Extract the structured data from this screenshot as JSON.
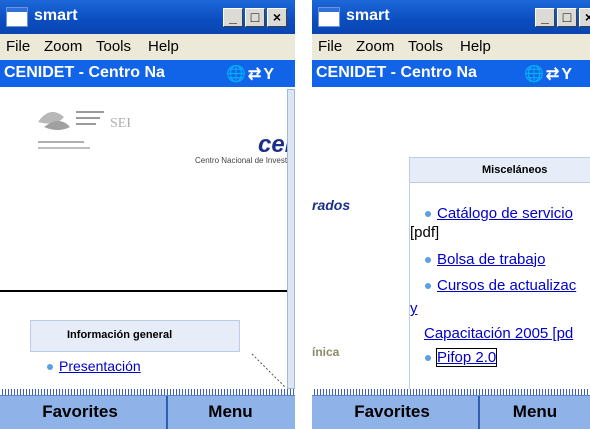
{
  "windows": [
    {
      "id": "left",
      "title": "smart",
      "controls": {
        "minimize": "_",
        "maximize": "□",
        "close": "×"
      },
      "menu": [
        "File",
        "Zoom",
        "Tools",
        "Help"
      ],
      "address": "CENIDET - Centro Na",
      "content": {
        "brand_partial": "cer",
        "center_text": "Centro Nacional de Invest",
        "section_title": "Información general",
        "links": [
          "Presentación"
        ]
      },
      "softkeys": {
        "left": "Favorites",
        "right": "Menu"
      }
    },
    {
      "id": "right",
      "title": "smart",
      "controls": {
        "minimize": "_",
        "maximize": "□",
        "close": "×"
      },
      "menu": [
        "File",
        "Zoom",
        "Tools",
        "Help"
      ],
      "address": "CENIDET - Centro Na",
      "content": {
        "side_label": "rados",
        "side_label2": "ínica",
        "box_title": "Misceláneos",
        "items": [
          {
            "text": "Catálogo de servicio",
            "suffix": "[pdf]"
          },
          {
            "text": "Bolsa de trabajo"
          },
          {
            "text": "Cursos de actualizac"
          },
          {
            "text": "y",
            "continued": "Capacitación 2005 [pd"
          },
          {
            "text": "Pifop 2.0"
          }
        ]
      },
      "softkeys": {
        "left": "Favorites",
        "right": "Menu"
      }
    }
  ],
  "icons": [
    "app-window-icon",
    "minimize-icon",
    "maximize-icon",
    "close-icon",
    "globe-icon",
    "sync-icon",
    "signal-icon"
  ]
}
